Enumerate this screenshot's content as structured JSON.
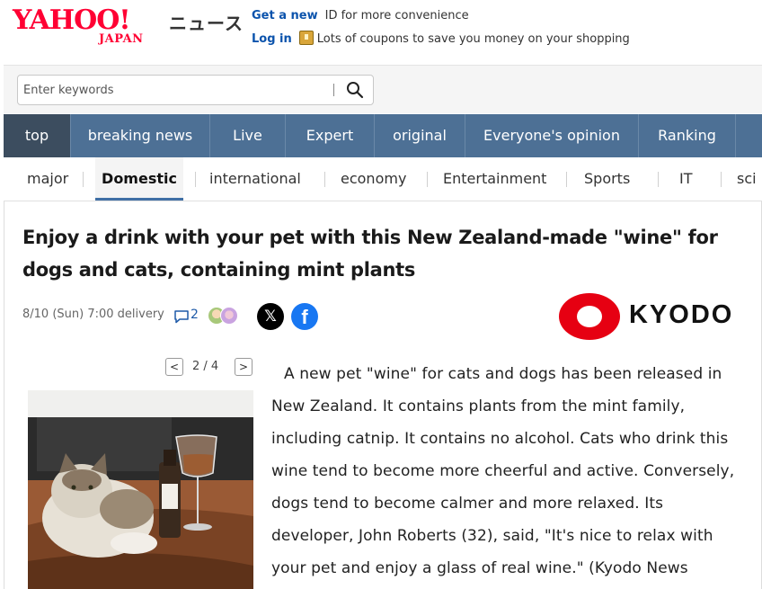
{
  "header": {
    "logo_text": "YAHOO!",
    "logo_sub": "JAPAN",
    "service_name": "ニュース",
    "promo1_link": "Get a new",
    "promo1_text": "ID for more convenience",
    "promo2_link": "Log in",
    "promo2_text": "Lots of coupons to save you money on your shopping"
  },
  "search": {
    "placeholder": "Enter keywords",
    "icon": "search-icon"
  },
  "topnav": {
    "items": [
      {
        "label": "top",
        "active": true
      },
      {
        "label": "breaking news"
      },
      {
        "label": "Live"
      },
      {
        "label": "Expert"
      },
      {
        "label": "original"
      },
      {
        "label": "Everyone's opinion"
      },
      {
        "label": "Ranking"
      }
    ]
  },
  "subnav": {
    "items": [
      {
        "label": "major"
      },
      {
        "label": "Domestic",
        "active": true
      },
      {
        "label": "international"
      },
      {
        "label": "economy"
      },
      {
        "label": "Entertainment"
      },
      {
        "label": "Sports"
      },
      {
        "label": "IT"
      },
      {
        "label": "sci"
      }
    ]
  },
  "article": {
    "headline": "Enjoy a drink with your pet with this New Zealand-made \"wine\" for dogs and cats, containing mint plants",
    "meta": "8/10 (Sun) 7:00 delivery",
    "comment_count": "2",
    "x_label": "𝕏",
    "fb_label": "f",
    "source": "KYODO",
    "pager": {
      "prev": "<",
      "next": ">",
      "current": "2 / 4"
    },
    "body": "A new pet \"wine\" for cats and dogs has been released in New Zealand. It contains plants from the mint family, including catnip. It contains no alcohol. Cats who drink this wine tend to become more cheerful and active. Conversely, dogs tend to become calmer and more relaxed. Its developer, John Roberts (32), said, \"It's nice to relax with your pet and enjoy a glass of real wine.\" (Kyodo News Sydney Bureau, Munehiro Yamaoka)"
  },
  "colors": {
    "brand": "#ff0033",
    "nav_bg": "#4d7095",
    "nav_active": "#3c4d5f",
    "link": "#0b53ac",
    "kyodo_red": "#e60012"
  }
}
